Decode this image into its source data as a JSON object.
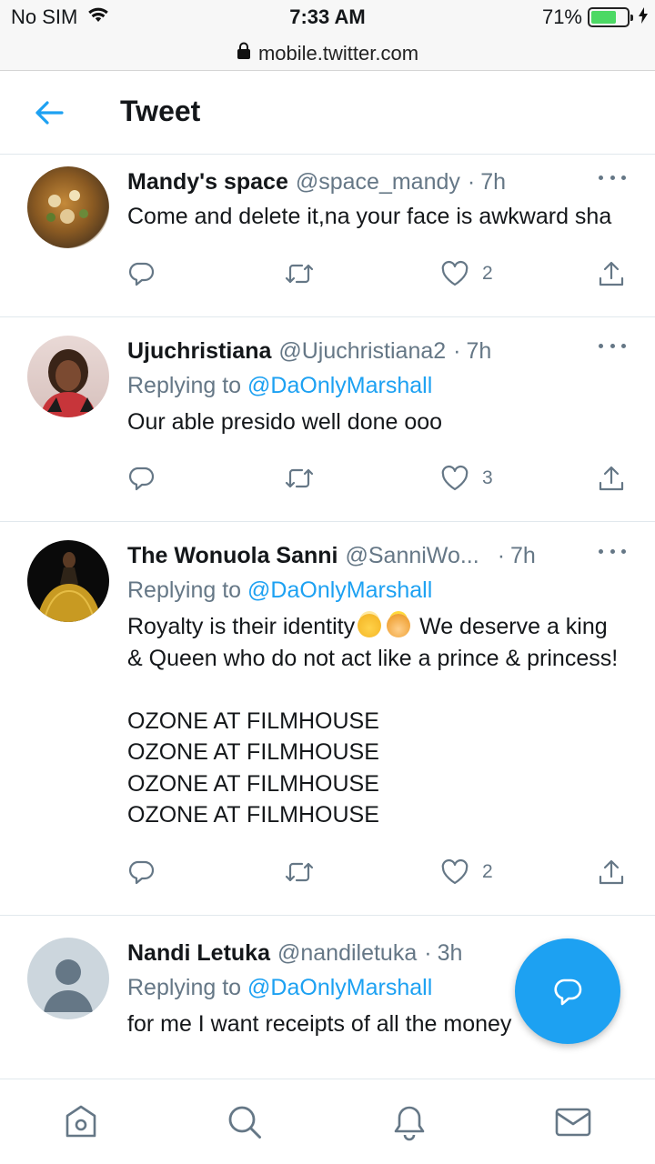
{
  "status_bar": {
    "carrier": "No SIM",
    "time": "7:33 AM",
    "battery_percent": "71%",
    "battery_level": 0.71,
    "battery_color": "#4cd964"
  },
  "browser": {
    "url": "mobile.twitter.com"
  },
  "header": {
    "title": "Tweet",
    "back_icon": "arrow-left-icon"
  },
  "colors": {
    "accent": "#1da1f2",
    "muted": "#657786",
    "text": "#14171a",
    "divider": "#e1e8ed"
  },
  "tweets": [
    {
      "name": "Mandy's space",
      "handle": "@space_mandy",
      "separator": "·",
      "time": "7h",
      "replying_label": "",
      "replying_to": "",
      "text": "Come and delete it,na your face is awkward sha",
      "likes": "2"
    },
    {
      "name": "Ujuchristiana",
      "handle": "@Ujuchristiana2",
      "separator": "·",
      "time": "7h",
      "replying_label": "Replying to",
      "replying_to": "@DaOnlyMarshall",
      "text": "Our able presido well done ooo",
      "likes": "3"
    },
    {
      "name": "The Wonuola Sanni",
      "handle": "@SanniWo...",
      "separator": "·",
      "time": "7h",
      "replying_label": "Replying to",
      "replying_to": "@DaOnlyMarshall",
      "text_line1_a": "Royalty is their identity",
      "text_line1_b": "We deserve a king & Queen who do not act like a prince & princess!",
      "text_rest": "\nOZONE AT FILMHOUSE\nOZONE AT FILMHOUSE\nOZONE AT FILMHOUSE\nOZONE AT FILMHOUSE",
      "emojis": [
        "angel-emoji",
        "princess-emoji"
      ],
      "likes": "2"
    },
    {
      "name": "Nandi Letuka",
      "handle": "@nandiletuka",
      "separator": "·",
      "time": "3h",
      "replying_label": "Replying to",
      "replying_to": "@DaOnlyMarshall",
      "text": "for me I want receipts of all the money"
    }
  ],
  "bottom_nav": [
    "home-icon",
    "search-icon",
    "notifications-icon",
    "messages-icon"
  ],
  "fab_icon": "reply-icon"
}
